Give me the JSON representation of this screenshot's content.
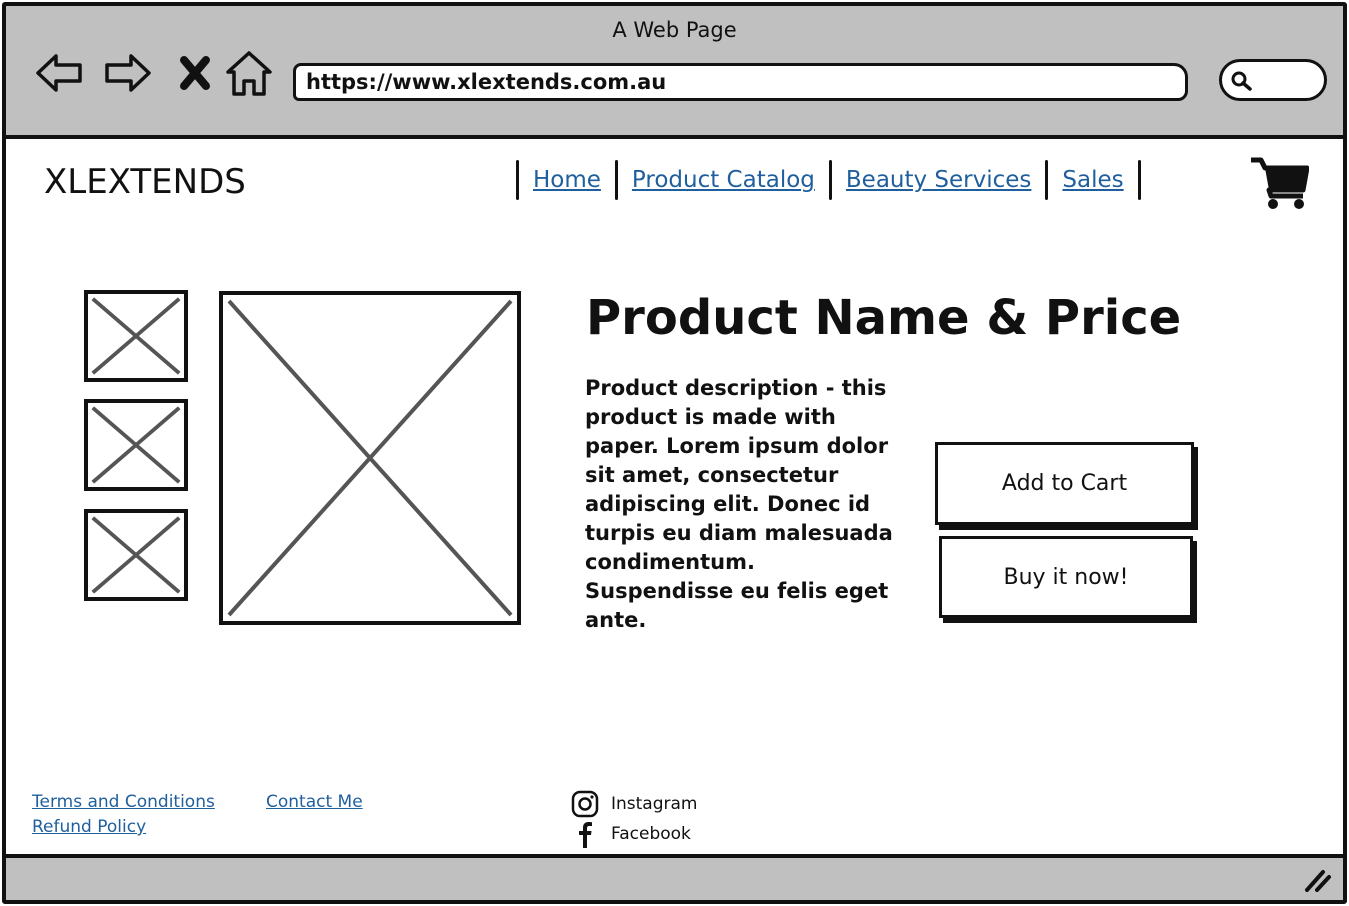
{
  "window": {
    "title": "A Web Page"
  },
  "browser": {
    "url": "https://www.xlextends.com.au",
    "icons": [
      "back-arrow-icon",
      "forward-arrow-icon",
      "close-x-icon",
      "home-icon",
      "search-icon"
    ]
  },
  "site": {
    "brand": "XLEXTENDS",
    "nav": [
      {
        "label": "Home"
      },
      {
        "label": "Product Catalog"
      },
      {
        "label": "Beauty Services"
      },
      {
        "label": "Sales"
      }
    ],
    "cart_icon": "shopping-cart-icon"
  },
  "product": {
    "title": "Product Name & Price",
    "description": "Product description - this product is made with paper. Lorem ipsum dolor sit amet, consectetur adipiscing elit. Donec id turpis eu diam malesuada condimentum. Suspendisse eu felis eget ante.",
    "add_to_cart": "Add to Cart",
    "buy_now": "Buy it now!"
  },
  "footer": {
    "links": {
      "terms": "Terms and Conditions",
      "contact": "Contact Me",
      "refund": "Refund Policy"
    },
    "social": {
      "instagram": "Instagram",
      "facebook": "Facebook"
    }
  },
  "colors": {
    "chrome": "#c0c0c0",
    "link": "#1f5f9e",
    "ink": "#111111",
    "placeholder_x": "#555555"
  }
}
